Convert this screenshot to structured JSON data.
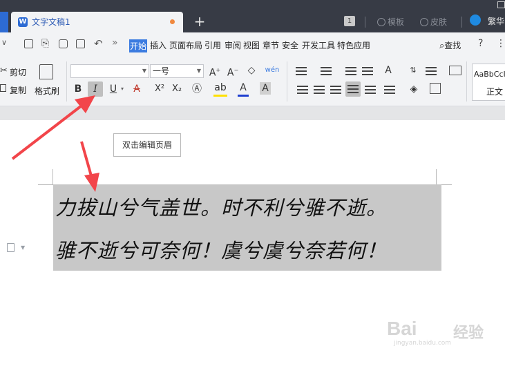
{
  "tabs": {
    "document_title": "文字文稿1",
    "new_tab": "+",
    "badge_number": "1",
    "template_label": "模板",
    "skin_label": "皮肤",
    "language_label": "繁华"
  },
  "menu": {
    "start": "开始",
    "insert": "插入",
    "page_layout": "页面布局",
    "references": "引用",
    "review": "审阅",
    "view": "视图",
    "section": "章节",
    "security": "安全",
    "developer": "开发工具",
    "special": "特色应用",
    "search": "查找",
    "help": "?",
    "more": "⋮",
    "overflow": "»"
  },
  "ribbon": {
    "cut": "剪切",
    "copy": "复制",
    "format_painter": "格式刷",
    "font_name": "",
    "font_size": "一号",
    "bold": "B",
    "italic": "I",
    "underline": "U",
    "superscript": "X²",
    "subscript": "X₂",
    "pinyin": "wén",
    "style_preview": "AaBbCcI",
    "style_normal": "正文"
  },
  "document": {
    "header_hint": "双击编辑页眉",
    "line1": "力拔山兮气盖世。时不利兮骓不逝。",
    "line2": "骓不逝兮可奈何！虞兮虞兮奈若何！"
  },
  "watermark": {
    "brand": "Bai",
    "brand_cn": "经验",
    "url": "jingyan.baidu.com"
  },
  "colors": {
    "titlebar": "#373b45",
    "accent": "#3b7be0",
    "selection": "#c8c8c8",
    "arrow": "#f2454a"
  }
}
